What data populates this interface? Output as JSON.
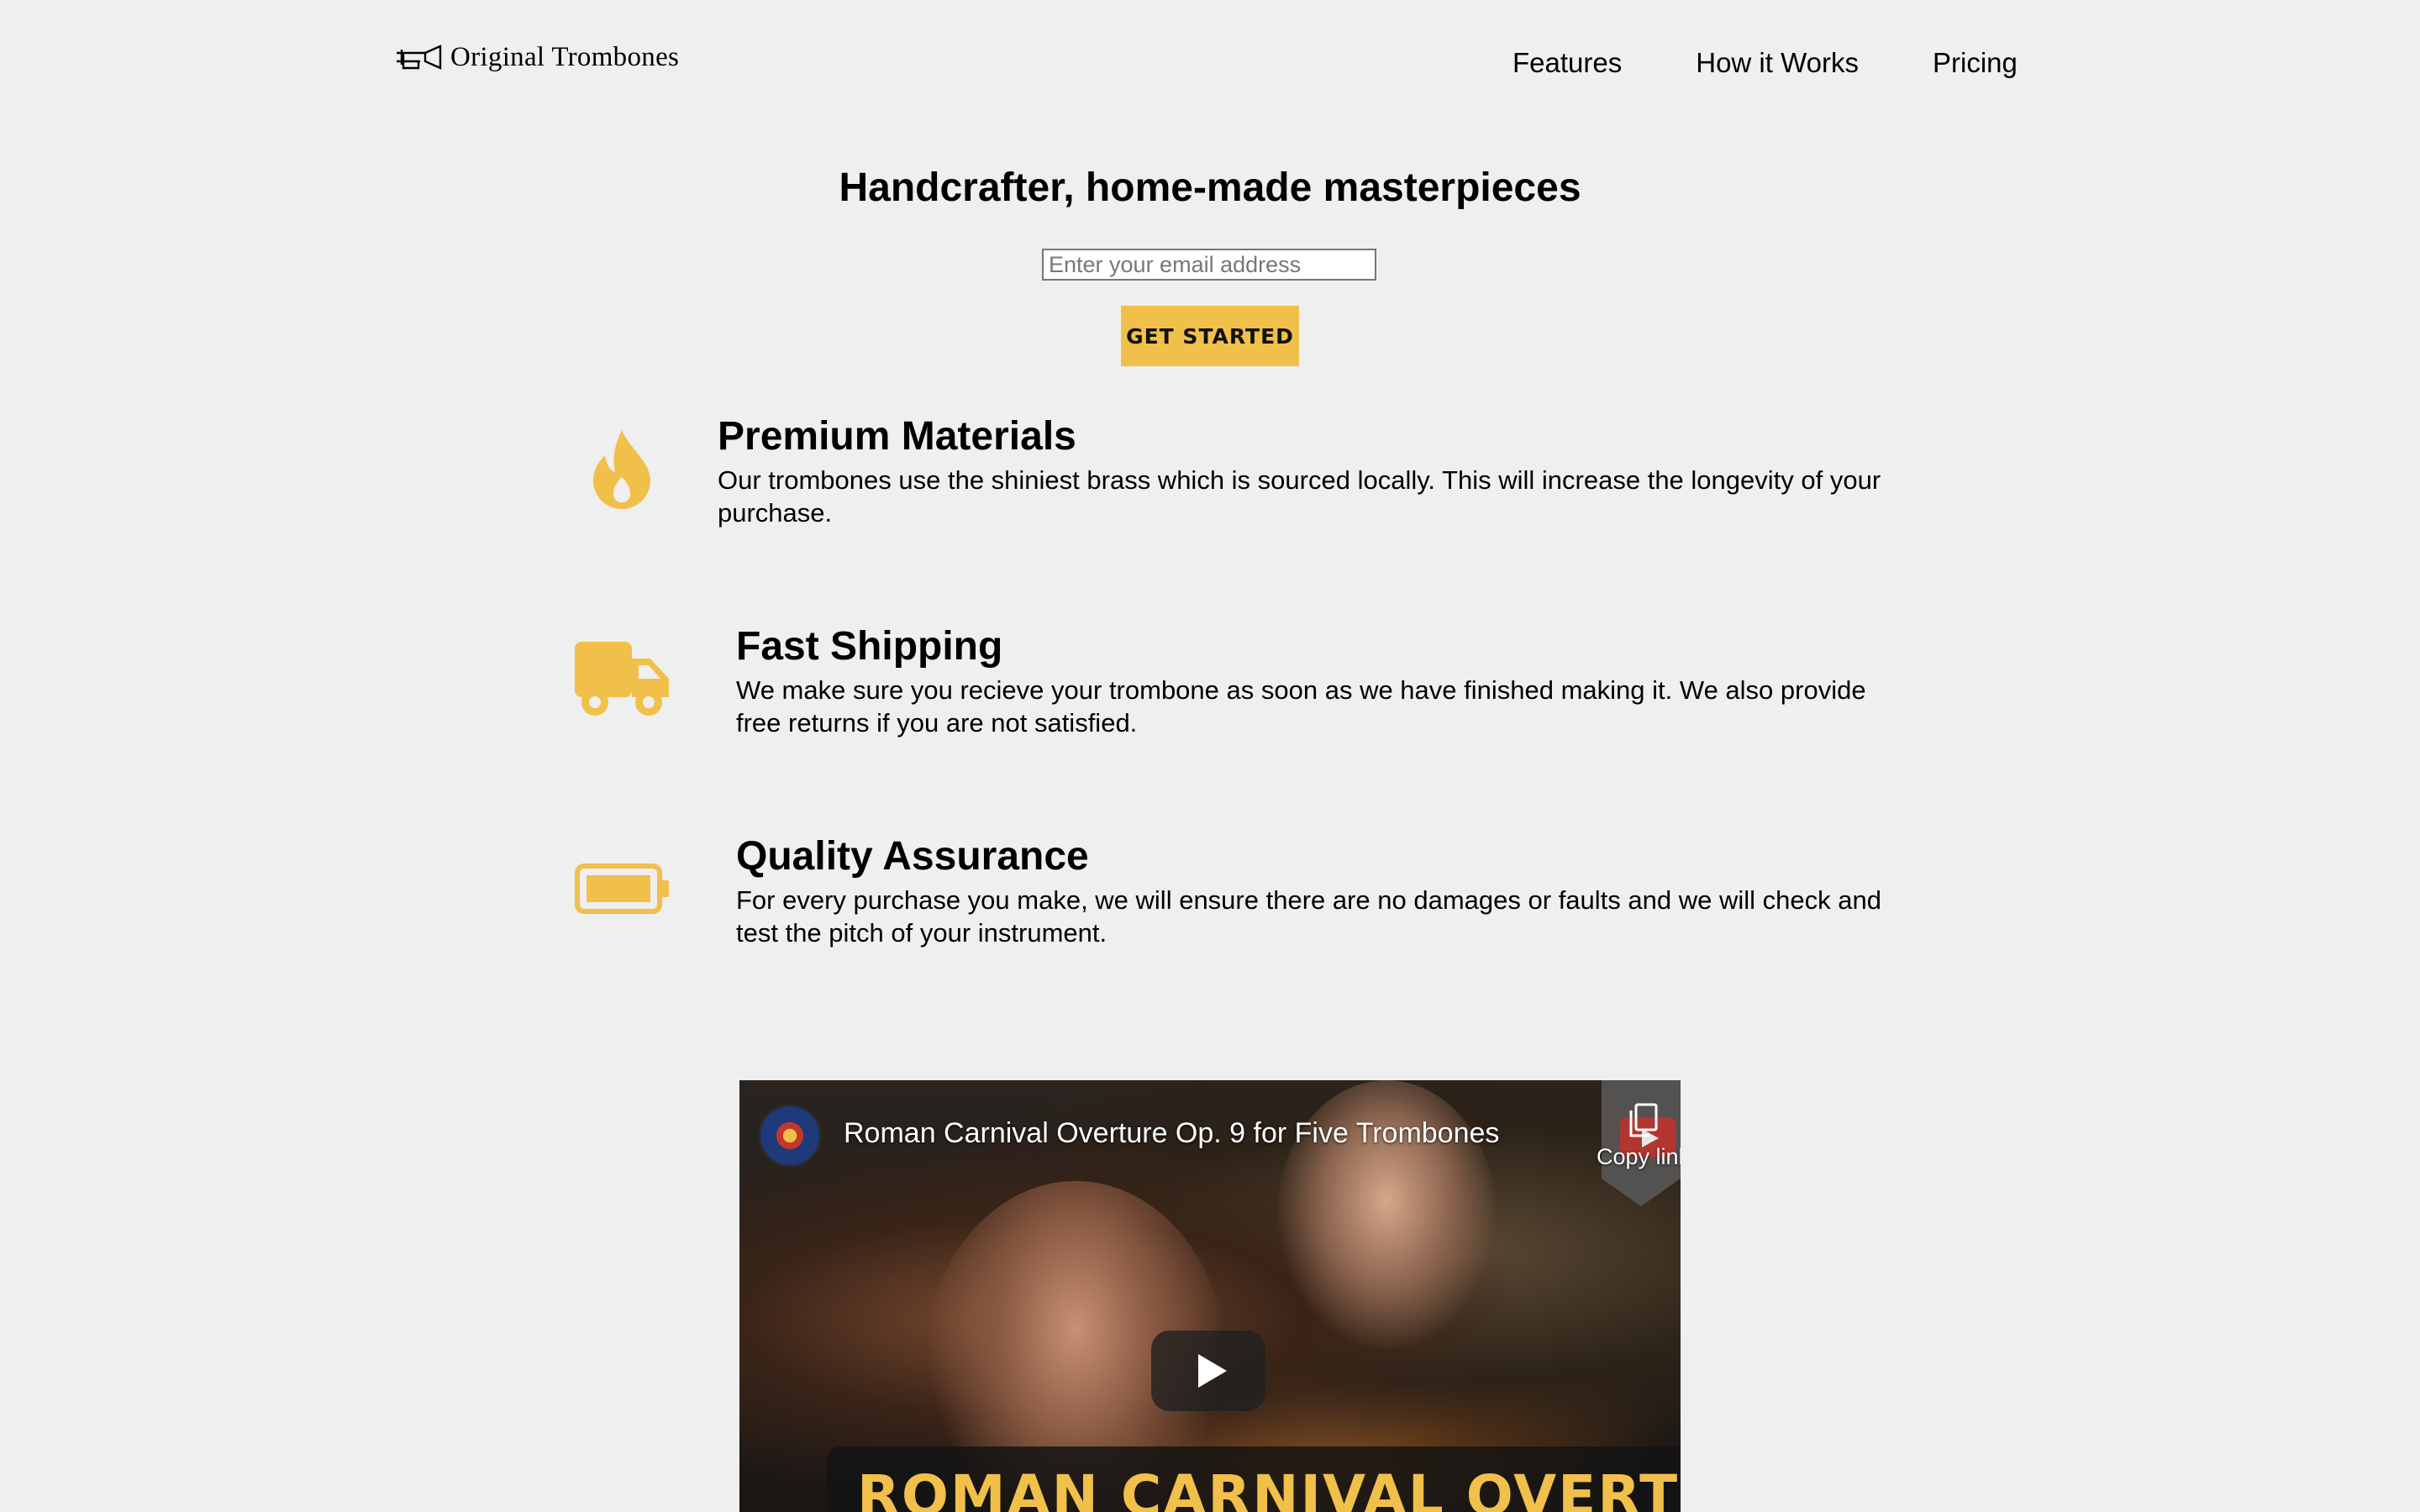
{
  "header": {
    "logo_text": "Original Trombones",
    "logo_icon": "trombone-icon",
    "nav": [
      {
        "label": "Features"
      },
      {
        "label": "How it Works"
      },
      {
        "label": "Pricing"
      }
    ]
  },
  "hero": {
    "title": "Handcrafter, home-made masterpieces",
    "email_placeholder": "Enter your email address",
    "cta_label": "GET STARTED"
  },
  "features": [
    {
      "icon": "fire-icon",
      "title": "Premium Materials",
      "text": "Our trombones use the shiniest brass which is sourced locally. This will increase the longevity of your purchase."
    },
    {
      "icon": "truck-icon",
      "title": "Fast Shipping",
      "text": "We make sure you recieve your trombone as soon as we have finished making it. We also provide free returns if you are not satisfied."
    },
    {
      "icon": "battery-full-icon",
      "title": "Quality Assurance",
      "text": "For every purchase you make, we will ensure there are no damages or faults and we will check and test the pitch of your instrument."
    }
  ],
  "video": {
    "title": "Roman Carnival Overture Op. 9 for Five Trombones",
    "copy_link_label": "Copy link",
    "banner_text": "ROMAN CARNIVAL OVERTURE"
  },
  "colors": {
    "accent": "#f1c04a",
    "background": "#efefef"
  }
}
